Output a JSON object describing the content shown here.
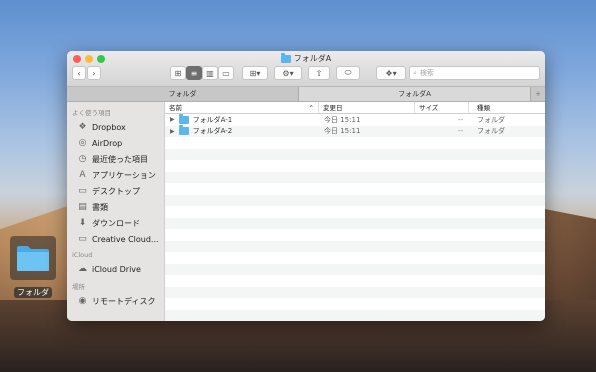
{
  "window": {
    "title": "フォルダA"
  },
  "toolbar": {
    "search_placeholder": "検索"
  },
  "tabs": [
    {
      "label": "フォルダ"
    },
    {
      "label": "フォルダA"
    }
  ],
  "sidebar": {
    "favorites_header": "よく使う項目",
    "favorites": [
      {
        "label": "Dropbox",
        "icon": "dropbox-icon"
      },
      {
        "label": "AirDrop",
        "icon": "airdrop-icon"
      },
      {
        "label": "最近使った項目",
        "icon": "clock-icon"
      },
      {
        "label": "アプリケーション",
        "icon": "applications-icon"
      },
      {
        "label": "デスクトップ",
        "icon": "desktop-icon"
      },
      {
        "label": "書類",
        "icon": "document-icon"
      },
      {
        "label": "ダウンロード",
        "icon": "download-icon"
      },
      {
        "label": "Creative Cloud...",
        "icon": "folder-icon"
      }
    ],
    "icloud_header": "iCloud",
    "icloud": [
      {
        "label": "iCloud Drive",
        "icon": "cloud-icon"
      }
    ],
    "locations_header": "場所",
    "locations": [
      {
        "label": "リモートディスク",
        "icon": "disk-icon"
      }
    ]
  },
  "columns": {
    "name": "名前",
    "date": "変更日",
    "size": "サイズ",
    "kind": "種類"
  },
  "files": [
    {
      "name": "フォルダA-1",
      "date": "今日 15:11",
      "size": "--",
      "kind": "フォルダ"
    },
    {
      "name": "フォルダA-2",
      "date": "今日 15:11",
      "size": "--",
      "kind": "フォルダ"
    }
  ],
  "desktop": {
    "icon_label": "フォルダ"
  },
  "colors": {
    "folder": "#5bb6ee",
    "close": "#fc605b",
    "minimize": "#fdbc40",
    "zoom": "#34c84a"
  }
}
